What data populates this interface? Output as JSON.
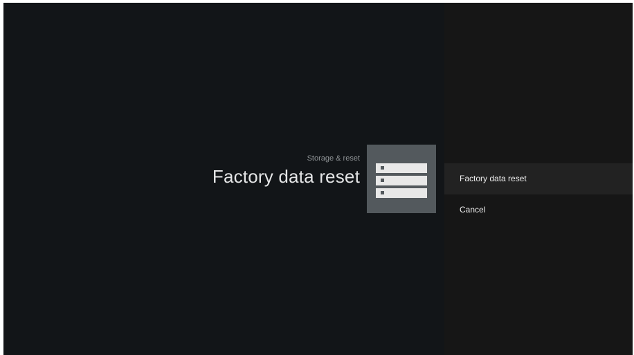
{
  "header": {
    "breadcrumb": "Storage & reset",
    "title": "Factory data reset",
    "icon": "storage-icon"
  },
  "actions": [
    {
      "label": "Factory data reset",
      "focused": true
    },
    {
      "label": "Cancel",
      "focused": false
    }
  ],
  "colors": {
    "background": "#121518",
    "action_panel": "#161616",
    "focused_item": "#222222",
    "icon_tile": "#53595d",
    "icon_bar": "#e8e8e8",
    "title_text": "#e4e5e6",
    "breadcrumb_text": "#8f9396"
  }
}
